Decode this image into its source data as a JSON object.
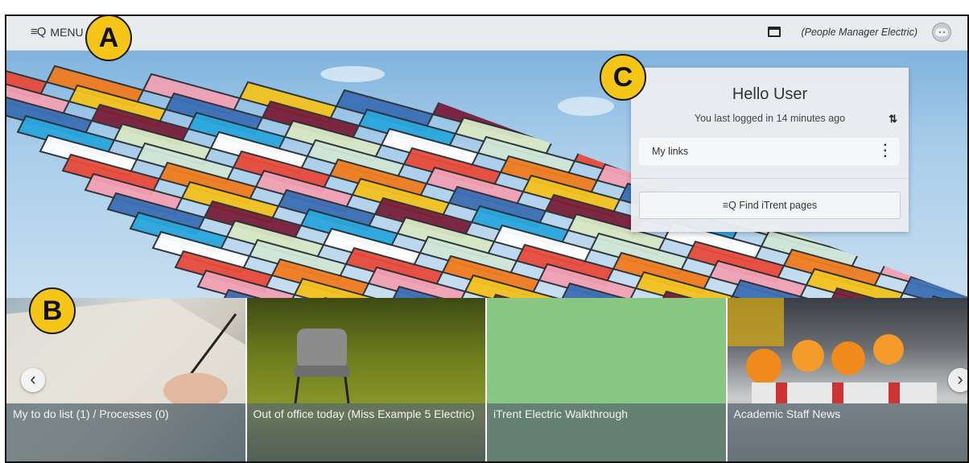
{
  "topbar": {
    "menu_label": "MENU",
    "menu_icon": "menu-search-icon",
    "role_text": "(People Manager Electric)"
  },
  "callouts": [
    "A",
    "B",
    "C"
  ],
  "welcome": {
    "greeting": "Hello User",
    "last_login": "You last logged in 14 minutes ago",
    "my_links_label": "My links",
    "find_label": "Find iTrent pages"
  },
  "tiles": [
    {
      "caption": "My to do list (1) / Processes (0)"
    },
    {
      "caption": "Out of office today (Miss Example 5 Electric)"
    },
    {
      "caption": "iTrent Electric Walkthrough",
      "color": "#87c783"
    },
    {
      "caption": "Academic Staff News"
    }
  ]
}
